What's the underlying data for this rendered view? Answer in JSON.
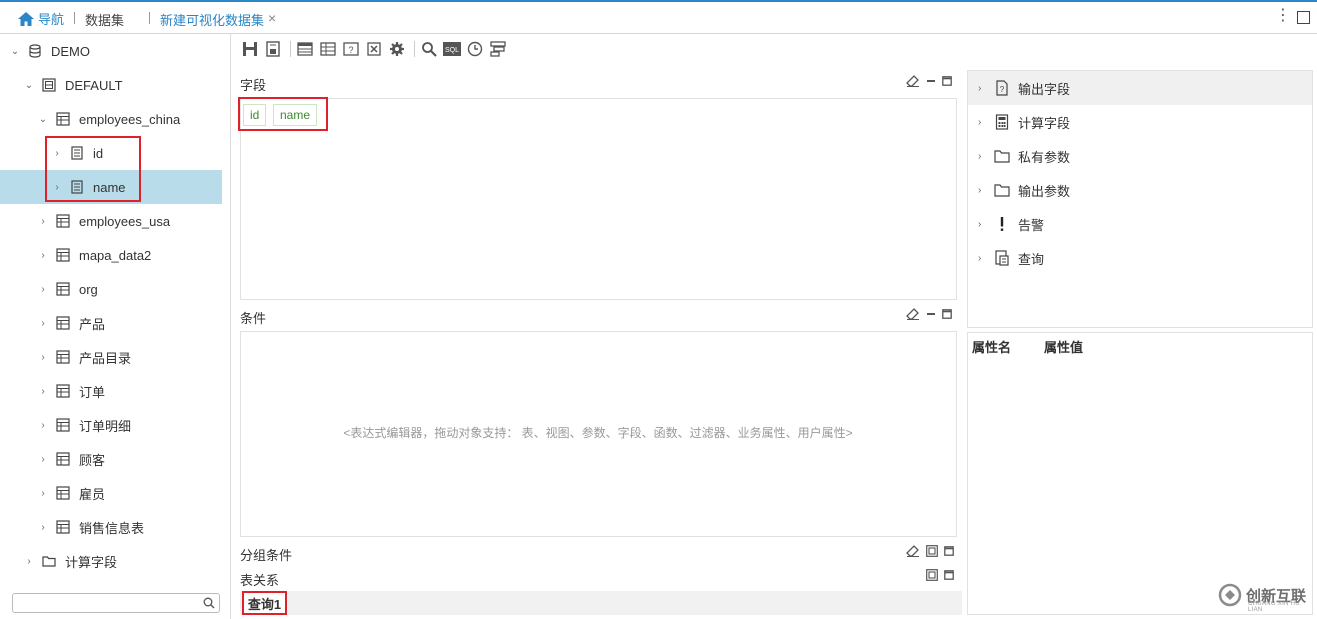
{
  "topbar": {
    "nav_label": "导航",
    "dataset_label": "数据集",
    "tab_label": "新建可视化数据集",
    "close_glyph": "×",
    "more_glyph": "⋮"
  },
  "tree": {
    "root": "DEMO",
    "schema": "DEFAULT",
    "tables": [
      {
        "label": "employees_china",
        "expanded": true,
        "children": [
          {
            "label": "id"
          },
          {
            "label": "name",
            "selected": true
          }
        ]
      },
      {
        "label": "employees_usa"
      },
      {
        "label": "mapa_data2"
      },
      {
        "label": "org"
      },
      {
        "label": "产品"
      },
      {
        "label": "产品目录"
      },
      {
        "label": "订单"
      },
      {
        "label": "订单明细"
      },
      {
        "label": "顾客"
      },
      {
        "label": "雇员"
      },
      {
        "label": "销售信息表"
      }
    ],
    "computed_folder": "计算字段",
    "search_placeholder": ""
  },
  "toolbar": {
    "icons": [
      "save-icon",
      "save-as-icon",
      "table-layout-icon",
      "grid-layout-icon",
      "help-layout-icon",
      "export-excel-icon",
      "settings-icon",
      "search-icon",
      "sql-icon",
      "history-icon",
      "filter-config-icon"
    ],
    "sql_text": "SQL"
  },
  "fields": {
    "title": "字段",
    "chips": [
      "id",
      "name"
    ]
  },
  "conditions": {
    "title": "条件",
    "placeholder": "<表达式编辑器，拖动对象支持： 表、视图、参数、字段、函数、过滤器、业务属性、用户属性>"
  },
  "group_conditions": {
    "title": "分组条件"
  },
  "table_relations": {
    "title": "表关系"
  },
  "query_tab": {
    "label": "查询1"
  },
  "right_panel": {
    "items": [
      {
        "label": "输出字段",
        "icon": "output-field-icon"
      },
      {
        "label": "计算字段",
        "icon": "calculator-icon"
      },
      {
        "label": "私有参数",
        "icon": "folder-icon"
      },
      {
        "label": "输出参数",
        "icon": "folder-icon"
      },
      {
        "label": "告警",
        "icon": "alert-icon"
      },
      {
        "label": "查询",
        "icon": "query-icon"
      }
    ],
    "prop_name_header": "属性名",
    "prop_value_header": "属性值"
  },
  "watermark": {
    "text": "创新互联",
    "sub": "CHUANG XIN HU LIAN"
  },
  "colors": {
    "accent": "#2a86c6",
    "selection": "#b9dcea",
    "highlight_box": "#e0212a",
    "chip_text": "#3c8a2e"
  }
}
